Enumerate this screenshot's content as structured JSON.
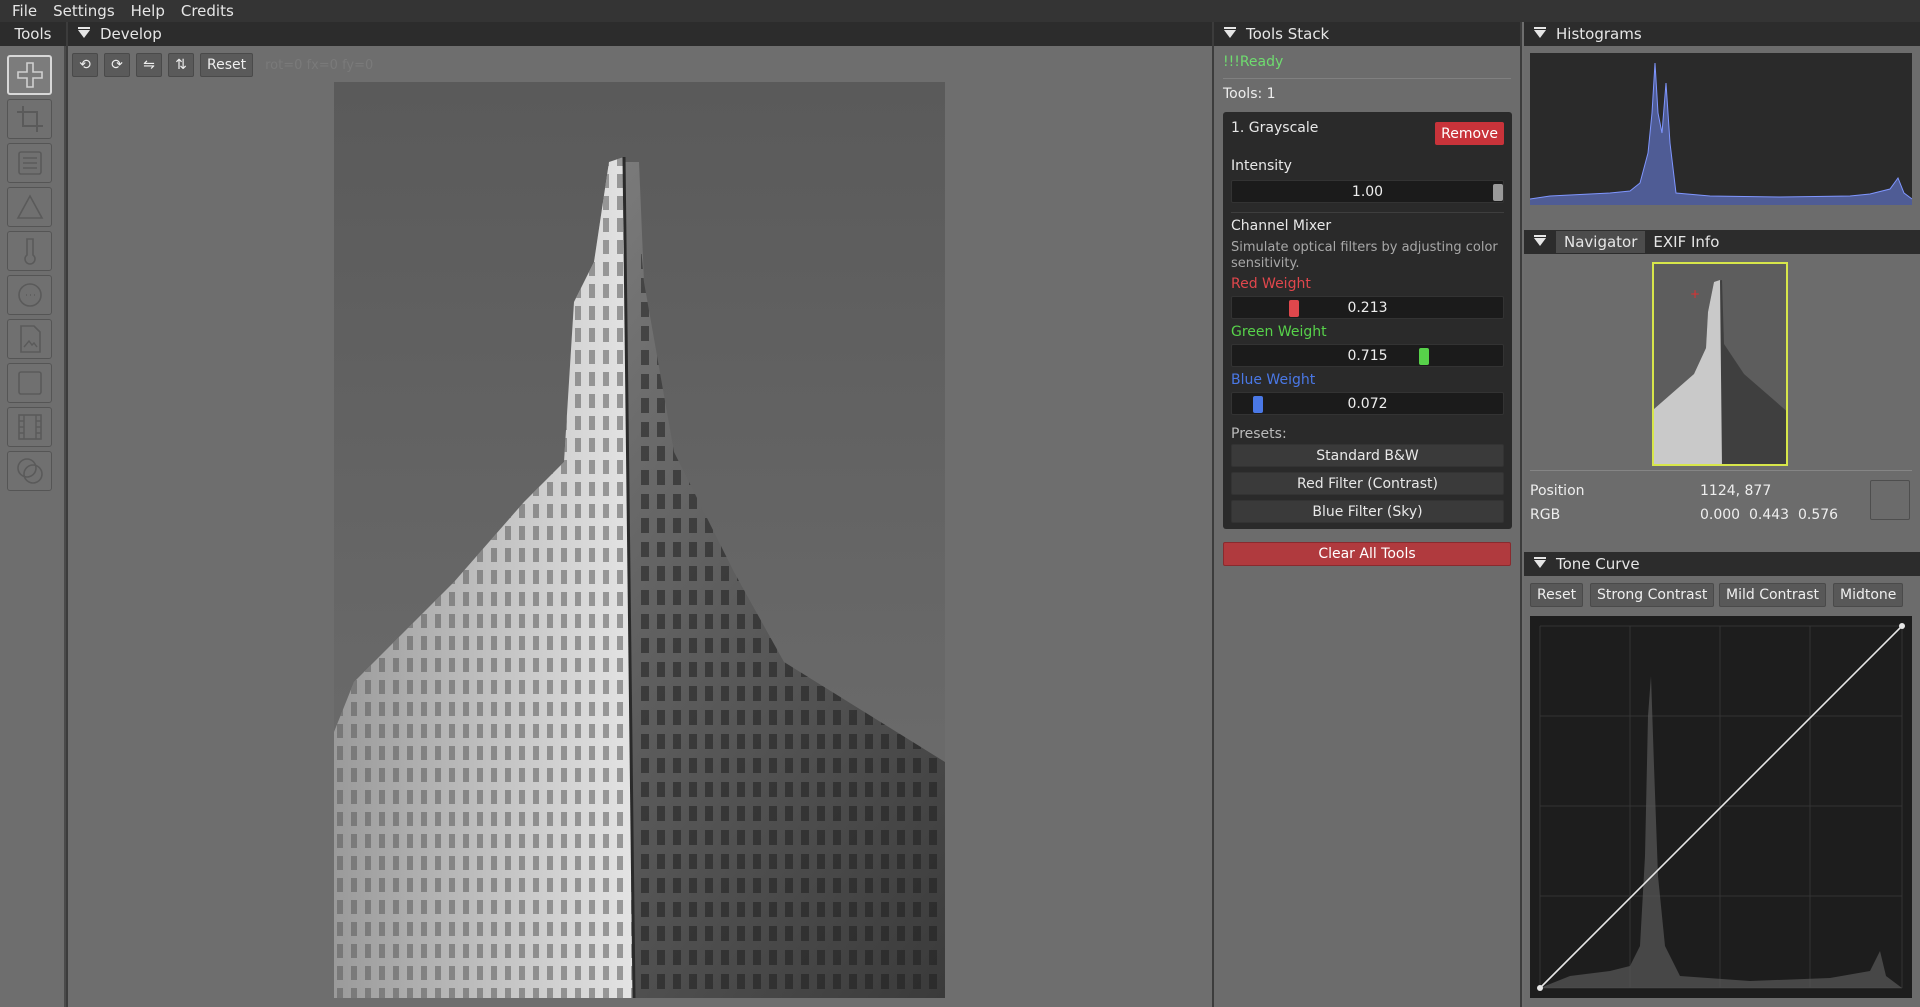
{
  "menu": [
    "File",
    "Settings",
    "Help",
    "Credits"
  ],
  "tools_panel": {
    "title": "Tools"
  },
  "develop": {
    "title": "Develop",
    "toolbar": {
      "rot_left": "⟲",
      "rot_right": "⟳",
      "flip_h": "⇋",
      "flip_v": "⇅",
      "reset": "Reset",
      "status": "rot=0 fx=0 fy=0"
    }
  },
  "tools_stack": {
    "title": "Tools Stack",
    "status": "!!!Ready",
    "count_label": "Tools: 1",
    "card": {
      "title": "1. Grayscale",
      "remove": "Remove",
      "intensity_label": "Intensity",
      "intensity_value": "1.00",
      "intensity": 1.0,
      "mixer_label": "Channel Mixer",
      "mixer_desc": "Simulate optical filters by adjusting color sensitivity.",
      "red_label": "Red Weight",
      "red_value": "0.213",
      "red": 0.213,
      "green_label": "Green Weight",
      "green_value": "0.715",
      "green": 0.715,
      "blue_label": "Blue Weight",
      "blue_value": "0.072",
      "blue": 0.072,
      "presets_label": "Presets:",
      "presets": [
        "Standard B&W",
        "Red Filter (Contrast)",
        "Blue Filter (Sky)"
      ]
    },
    "clear": "Clear All Tools",
    "colors": {
      "red": "#e0474c",
      "green": "#57d24a",
      "blue": "#4a78e6",
      "ready": "#6fdc6f"
    }
  },
  "histograms": {
    "title": "Histograms"
  },
  "navigator": {
    "tabs": [
      "Navigator",
      "EXIF Info"
    ],
    "position_label": "Position",
    "position_value": "1124, 877",
    "rgb_label": "RGB",
    "rgb_values": "0.000  0.443  0.576"
  },
  "tone_curve": {
    "title": "Tone Curve",
    "buttons": [
      "Reset",
      "Strong Contrast",
      "Mild Contrast",
      "Midtone"
    ]
  }
}
